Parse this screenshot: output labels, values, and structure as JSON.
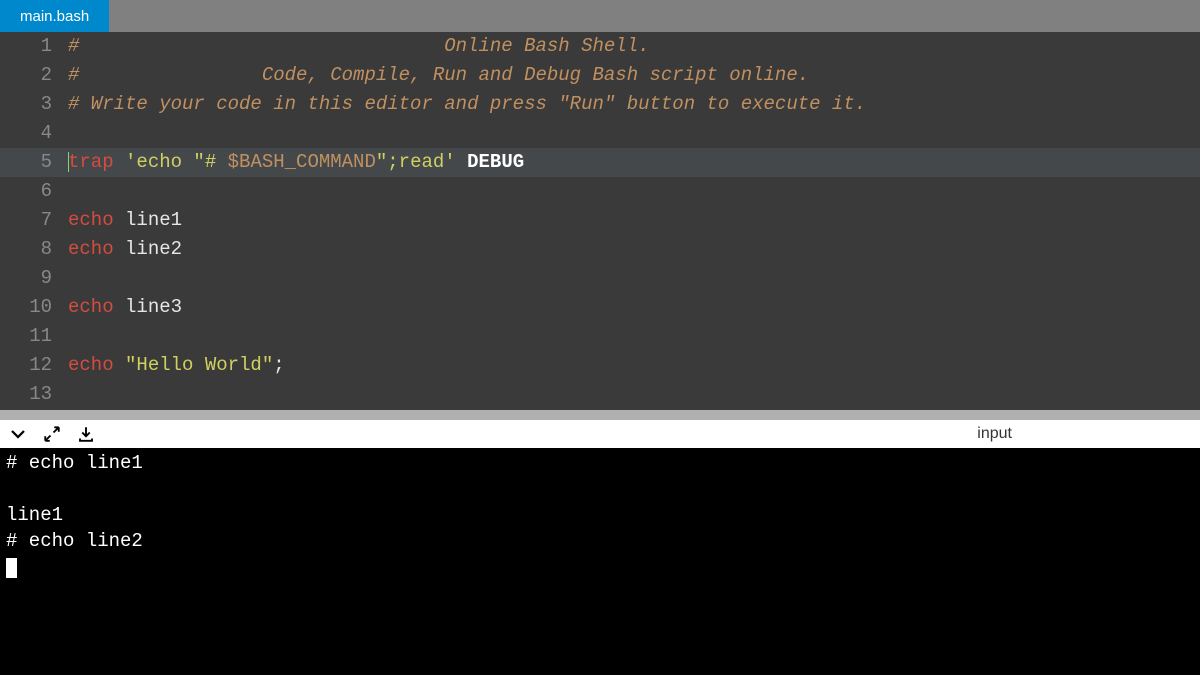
{
  "tab": {
    "label": "main.bash"
  },
  "editor": {
    "active_line": 5,
    "lines": [
      {
        "num": "1",
        "tokens": [
          {
            "cls": "tok-comment",
            "t": "#                                Online Bash Shell."
          }
        ]
      },
      {
        "num": "2",
        "tokens": [
          {
            "cls": "tok-comment",
            "t": "#                Code, Compile, Run and Debug Bash script online."
          }
        ]
      },
      {
        "num": "3",
        "tokens": [
          {
            "cls": "tok-comment",
            "t": "# Write your code in this editor and press \"Run\" button to execute it."
          }
        ]
      },
      {
        "num": "4",
        "tokens": []
      },
      {
        "num": "5",
        "tokens": [
          {
            "cls": "tok-keyword",
            "t": "trap"
          },
          {
            "cls": "tok-text",
            "t": " "
          },
          {
            "cls": "tok-string",
            "t": "'echo \"# "
          },
          {
            "cls": "tok-var",
            "t": "$BASH_COMMAND"
          },
          {
            "cls": "tok-string",
            "t": "\";read'"
          },
          {
            "cls": "tok-text",
            "t": " "
          },
          {
            "cls": "tok-debug",
            "t": "DEBUG"
          }
        ]
      },
      {
        "num": "6",
        "tokens": []
      },
      {
        "num": "7",
        "tokens": [
          {
            "cls": "tok-keyword",
            "t": "echo"
          },
          {
            "cls": "tok-text",
            "t": " line1"
          }
        ]
      },
      {
        "num": "8",
        "tokens": [
          {
            "cls": "tok-keyword",
            "t": "echo"
          },
          {
            "cls": "tok-text",
            "t": " line2"
          }
        ]
      },
      {
        "num": "9",
        "tokens": []
      },
      {
        "num": "10",
        "tokens": [
          {
            "cls": "tok-keyword",
            "t": "echo"
          },
          {
            "cls": "tok-text",
            "t": " line3"
          }
        ]
      },
      {
        "num": "11",
        "tokens": []
      },
      {
        "num": "12",
        "tokens": [
          {
            "cls": "tok-keyword",
            "t": "echo"
          },
          {
            "cls": "tok-text",
            "t": " "
          },
          {
            "cls": "tok-string",
            "t": "\"Hello World\""
          },
          {
            "cls": "tok-text",
            "t": ";"
          }
        ]
      },
      {
        "num": "13",
        "tokens": []
      }
    ]
  },
  "toolbar": {
    "input_label": "input"
  },
  "terminal": {
    "lines": [
      "# echo line1",
      "",
      "line1",
      "# echo line2"
    ]
  }
}
